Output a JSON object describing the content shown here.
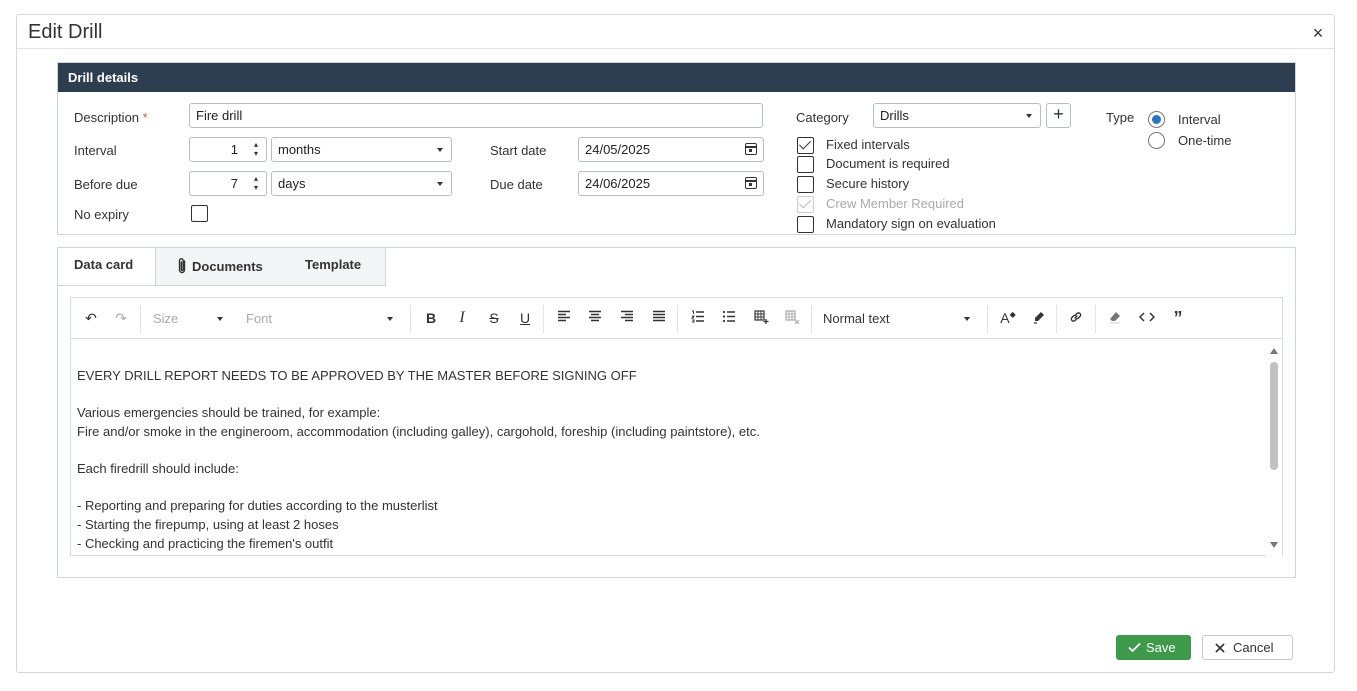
{
  "dialog": {
    "title": "Edit Drill",
    "close": "×"
  },
  "details": {
    "header": "Drill details",
    "description_label": "Description",
    "required_mark": "*",
    "description_value": "Fire drill",
    "interval_label": "Interval",
    "interval_value": "1",
    "interval_unit": "months",
    "before_due_label": "Before due",
    "before_due_value": "7",
    "before_due_unit": "days",
    "no_expiry_label": "No expiry",
    "start_date_label": "Start date",
    "start_date_value": "24/05/2025",
    "due_date_label": "Due date",
    "due_date_value": "24/06/2025",
    "category_label": "Category",
    "category_value": "Drills",
    "add_category": "+",
    "type_label": "Type",
    "type_options": [
      "Interval",
      "One-time"
    ],
    "type_selected": "Interval",
    "checkboxes": [
      {
        "label": "Fixed intervals",
        "checked": true,
        "disabled": false
      },
      {
        "label": "Document is required",
        "checked": false,
        "disabled": false
      },
      {
        "label": "Secure history",
        "checked": false,
        "disabled": false
      },
      {
        "label": "Crew Member Required",
        "checked": true,
        "disabled": true
      },
      {
        "label": "Mandatory sign on evaluation",
        "checked": false,
        "disabled": false
      }
    ]
  },
  "tabs": [
    {
      "label": "Data card",
      "active": true
    },
    {
      "label": "Documents",
      "icon": "paperclip-icon",
      "active": false
    },
    {
      "label": "Template",
      "active": false
    }
  ],
  "toolbar": {
    "size_placeholder": "Size",
    "font_placeholder": "Font",
    "paragraph_style": "Normal text",
    "bold": "B",
    "italic": "I",
    "strike": "S",
    "underline": "U",
    "quote": "”"
  },
  "editor_content": [
    "EVERY DRILL REPORT NEEDS TO BE APPROVED BY THE MASTER BEFORE SIGNING OFF",
    "",
    "Various emergencies should be trained, for example:",
    "Fire and/or smoke in the engineroom, accommodation (including galley), cargohold, foreship (including paintstore), etc.",
    "",
    "Each firedrill should include:",
    "",
    "- Reporting and preparing for duties according to the musterlist",
    "- Starting the firepump, using at least 2 hoses",
    "- Checking and practicing the firemen's outfit"
  ],
  "footer": {
    "save_label": "Save",
    "cancel_label": "Cancel"
  },
  "colors": {
    "header_bg": "#2d3e50",
    "save_bg": "#3d9a4a",
    "radio_accent": "#2a74c8",
    "required": "#d9534f"
  }
}
